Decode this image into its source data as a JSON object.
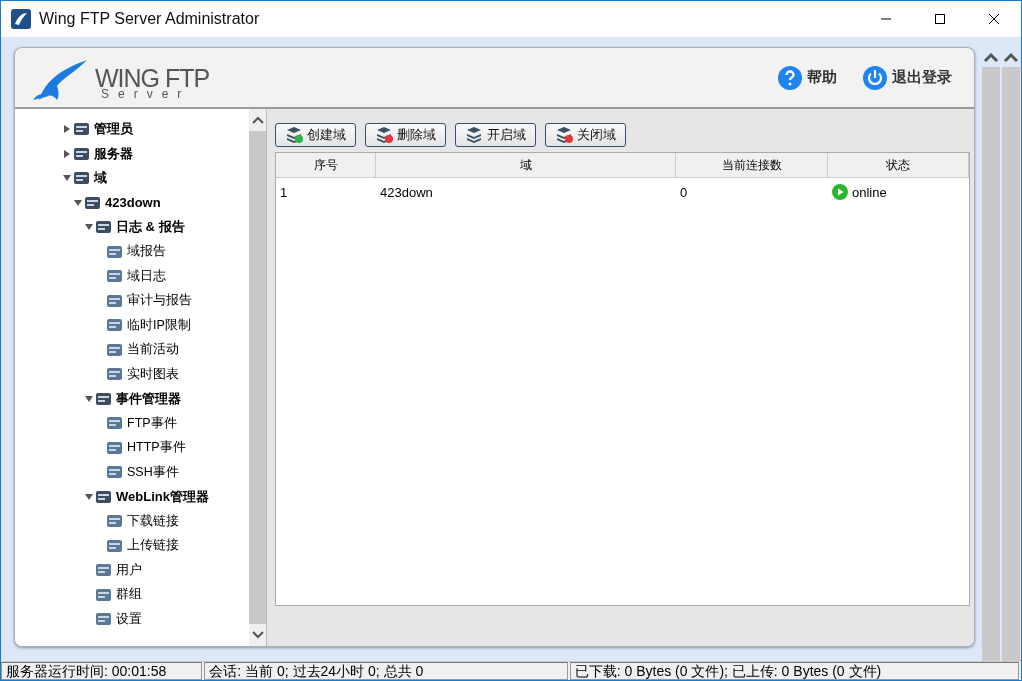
{
  "window": {
    "title": "Wing FTP Server Administrator"
  },
  "header": {
    "logo_main": "WING FTP",
    "logo_sub": "Server",
    "links": [
      {
        "label": "帮助",
        "kind": "help"
      },
      {
        "label": "退出登录",
        "kind": "logout"
      }
    ]
  },
  "tree": [
    {
      "label": "管理员",
      "expanded": false
    },
    {
      "label": "服务器",
      "expanded": false
    },
    {
      "label": "域",
      "expanded": true,
      "children": [
        {
          "label": "423down",
          "expanded": true,
          "children": [
            {
              "label": "日志 & 报告",
              "expanded": true,
              "children": [
                {
                  "label": "域报告"
                },
                {
                  "label": "域日志"
                },
                {
                  "label": "审计与报告"
                },
                {
                  "label": "临时IP限制"
                },
                {
                  "label": "当前活动"
                },
                {
                  "label": "实时图表"
                }
              ]
            },
            {
              "label": "事件管理器",
              "expanded": true,
              "children": [
                {
                  "label": "FTP事件"
                },
                {
                  "label": "HTTP事件"
                },
                {
                  "label": "SSH事件"
                }
              ]
            },
            {
              "label": "WebLink管理器",
              "expanded": true,
              "children": [
                {
                  "label": "下载链接"
                },
                {
                  "label": "上传链接"
                }
              ]
            },
            {
              "label": "用户"
            },
            {
              "label": "群组"
            },
            {
              "label": "设置"
            }
          ]
        }
      ]
    }
  ],
  "toolbar": [
    {
      "label": "创建域",
      "kind": "add"
    },
    {
      "label": "删除域",
      "kind": "delete"
    },
    {
      "label": "开启域",
      "kind": "start"
    },
    {
      "label": "关闭域",
      "kind": "stop"
    }
  ],
  "table": {
    "columns": [
      "序号",
      "域",
      "当前连接数",
      "状态"
    ],
    "rows": [
      [
        "1",
        "423down",
        "0",
        "online"
      ]
    ]
  },
  "status_bar": [
    "服务器运行时间: 00:01:58",
    "会话: 当前 0;  过去24小时 0;  总共 0",
    "已下载: 0 Bytes (0 文件);  已上传: 0 Bytes (0 文件)"
  ]
}
